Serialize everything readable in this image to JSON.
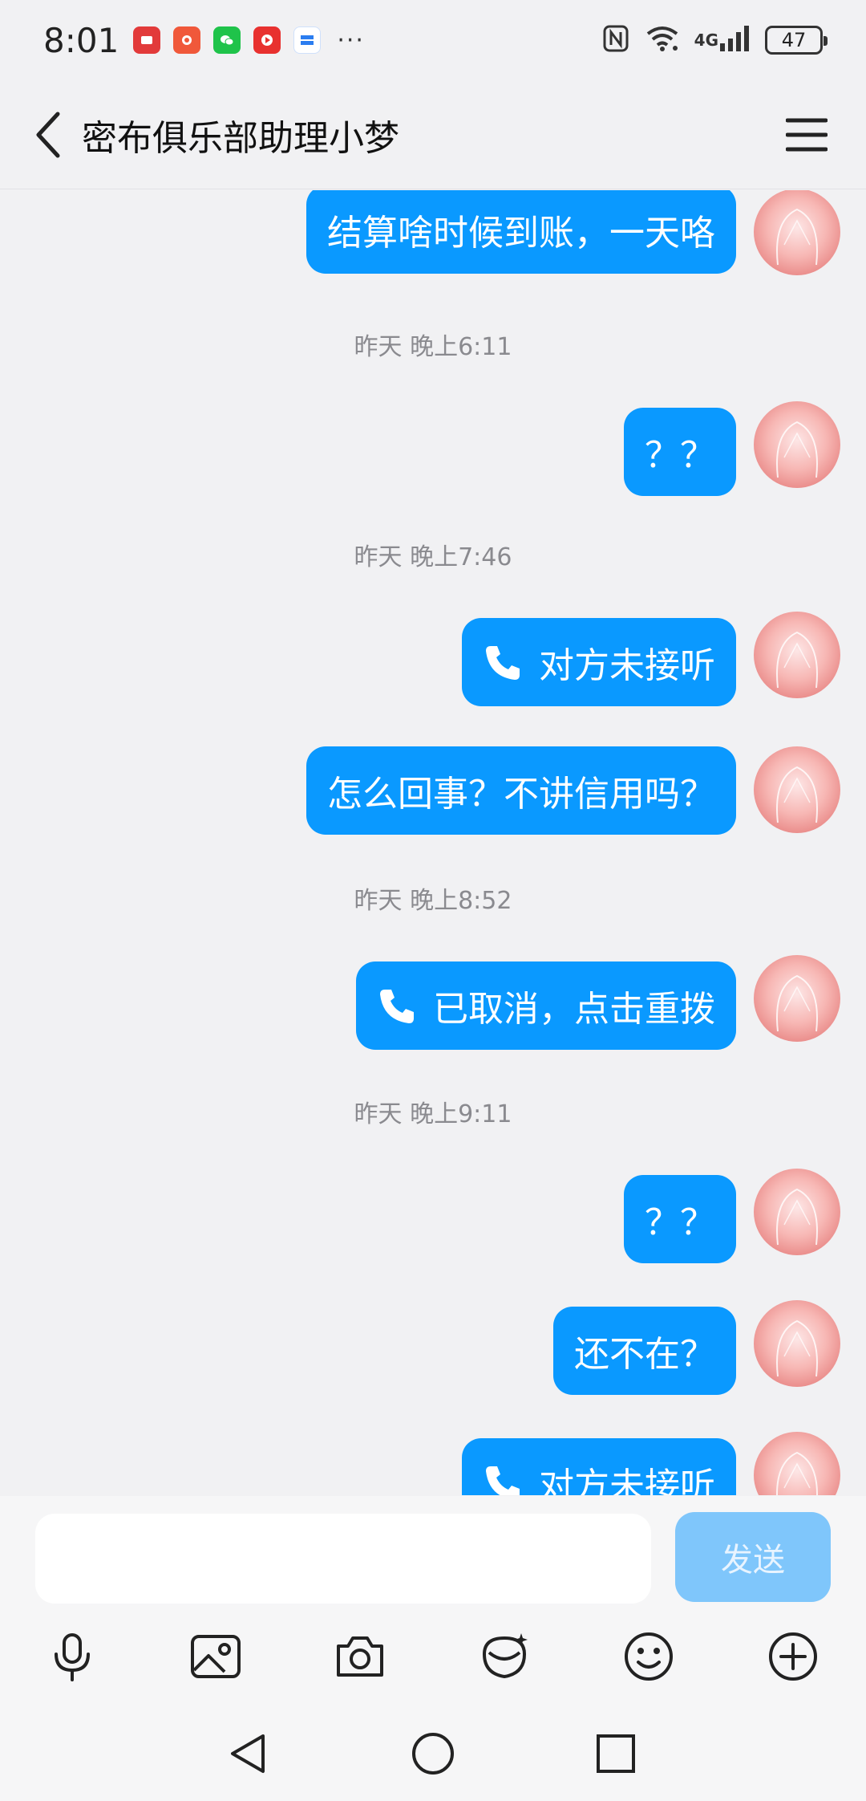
{
  "status_bar": {
    "time": "8:01",
    "apps": [
      {
        "name": "huawei-app-icon",
        "color": "#e23a3a"
      },
      {
        "name": "flower-app-icon",
        "color": "#f0583a"
      },
      {
        "name": "wechat-icon",
        "color": "#1fc34a"
      },
      {
        "name": "video-app-icon",
        "color": "#e8312f"
      },
      {
        "name": "live-app-icon",
        "color": "#2b7df0"
      }
    ],
    "more": "···",
    "network": "4G",
    "battery": "47"
  },
  "header": {
    "title": "密布俱乐部助理小梦"
  },
  "messages": [
    {
      "kind": "text",
      "text": "结算啥时候到账，一天咯"
    },
    {
      "kind": "time",
      "text": "昨天 晚上6:11"
    },
    {
      "kind": "text",
      "text": "？？"
    },
    {
      "kind": "time",
      "text": "昨天 晚上7:46"
    },
    {
      "kind": "call",
      "text": "对方未接听"
    },
    {
      "kind": "text",
      "text": "怎么回事？不讲信用吗？"
    },
    {
      "kind": "time",
      "text": "昨天 晚上8:52"
    },
    {
      "kind": "call",
      "text": "已取消，点击重拨"
    },
    {
      "kind": "time",
      "text": "昨天 晚上9:11"
    },
    {
      "kind": "text",
      "text": "？？"
    },
    {
      "kind": "text",
      "text": "还不在？"
    },
    {
      "kind": "call",
      "text": "对方未接听"
    }
  ],
  "input": {
    "value": "",
    "placeholder": "",
    "send_label": "发送"
  },
  "toolbar": [
    "microphone-icon",
    "image-icon",
    "camera-icon",
    "red-packet-icon",
    "emoji-icon",
    "plus-icon"
  ],
  "colors": {
    "bubble": "#0a99ff",
    "send_disabled": "#7fc6fb",
    "background": "#f1f1f3"
  }
}
